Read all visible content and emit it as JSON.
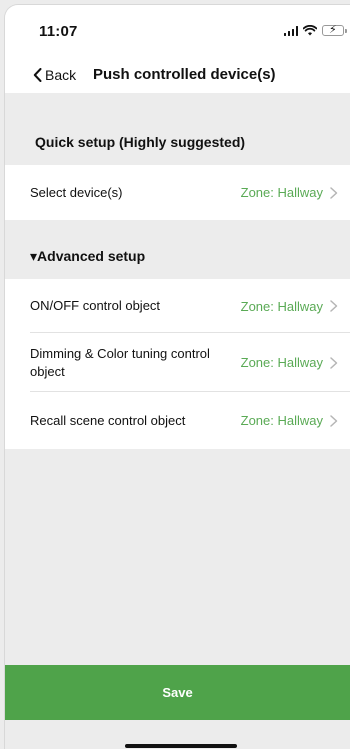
{
  "status_bar": {
    "time": "11:07",
    "battery_color": "#35c759"
  },
  "nav": {
    "back_label": "Back",
    "title": "Push controlled device(s)"
  },
  "quick_setup": {
    "header": "Quick setup (Highly suggested)",
    "rows": [
      {
        "label": "Select device(s)",
        "value": "Zone: Hallway"
      }
    ]
  },
  "advanced_setup": {
    "header": "▾Advanced setup",
    "rows": [
      {
        "label": "ON/OFF control object",
        "value": "Zone: Hallway"
      },
      {
        "label": "Dimming & Color tuning control object",
        "value": "Zone: Hallway"
      },
      {
        "label": "Recall scene control object",
        "value": "Zone: Hallway"
      }
    ]
  },
  "footer": {
    "save_label": "Save"
  },
  "colors": {
    "accent_green": "#4fa34a",
    "value_green": "#5aaa55",
    "background": "#ececec"
  }
}
